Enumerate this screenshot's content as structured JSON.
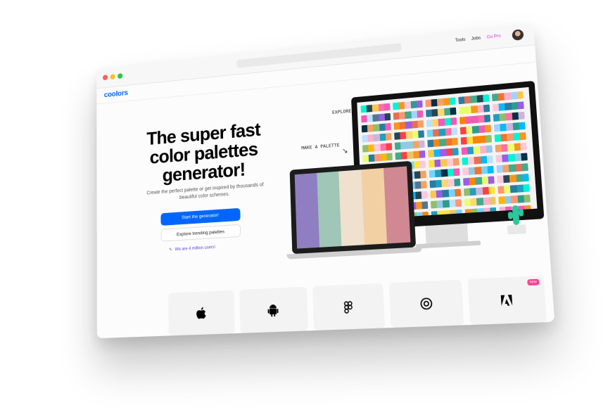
{
  "topnav": {
    "tools": "Tools",
    "jobs": "Jobs",
    "gopro": "Go Pro"
  },
  "logo": "coolors",
  "hero": {
    "title": "The super fast color palettes generator!",
    "subtitle": "Create the perfect palette or get inspired by thousands of beautiful color schemes.",
    "primary_button": "Start the generator!",
    "secondary_button": "Explore trending palettes",
    "million": "We are 4 million users!"
  },
  "illustration": {
    "explore_label": "EXPLORE",
    "make_label": "MAKE A PALETTE",
    "laptop_palette": [
      "#8f7ec1",
      "#9fc6b7",
      "#efe1cd",
      "#f2d0a4",
      "#d08893"
    ]
  },
  "cards": [
    {
      "icon": "apple-icon"
    },
    {
      "icon": "android-icon"
    },
    {
      "icon": "figma-icon"
    },
    {
      "icon": "chrome-icon"
    },
    {
      "icon": "adobe-icon",
      "badge": "new"
    }
  ]
}
